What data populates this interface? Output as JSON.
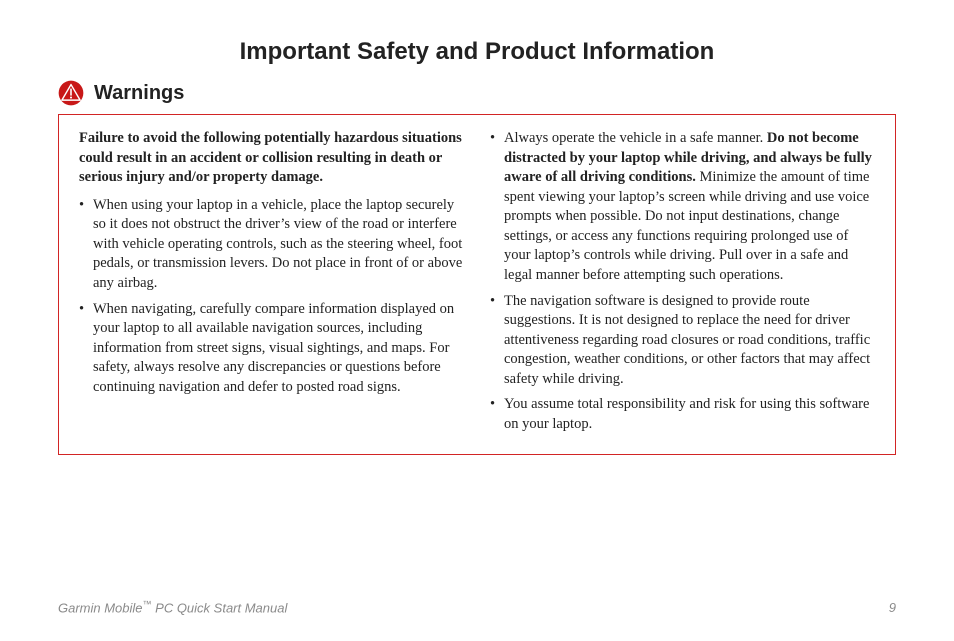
{
  "title": "Important Safety and Product Information",
  "warnings_heading": "Warnings",
  "intro": "Failure to avoid the following potentially hazardous situations could result in an accident or collision resulting in death or serious injury and/or property damage.",
  "left_items": [
    "When using your laptop in a vehicle, place the laptop securely so it does not obstruct the driver’s view of the road or interfere with vehicle operating controls, such as the steering wheel, foot pedals, or transmission levers. Do not place in front of or above any airbag.",
    "When navigating, carefully compare information displayed on your laptop to all available navigation sources, including information from street signs, visual sightings, and maps. For safety, always resolve any discrepancies or questions before continuing navigation and defer to posted road signs."
  ],
  "right_item1_lead": "Always operate the vehicle in a safe manner. ",
  "right_item1_bold": "Do not become distracted by your laptop while driving, and always be fully aware of all driving conditions.",
  "right_item1_tail": " Minimize the amount of time spent viewing your laptop’s screen while driving and use voice prompts when possible. Do not input destinations, change settings, or access any functions requiring prolonged use of your laptop’s controls while driving. Pull over in a safe and legal manner before attempting such operations.",
  "right_item2": "The navigation software is designed to provide route suggestions. It is not designed to replace the need for driver attentiveness regarding road closures or road conditions, traffic congestion, weather conditions, or other factors that may affect safety while driving.",
  "right_item3": "You assume total responsibility and risk for using this software on your laptop.",
  "footer_brand": "Garmin Mobile",
  "footer_tm": "™",
  "footer_rest": " PC Quick Start Manual",
  "page_number": "9"
}
